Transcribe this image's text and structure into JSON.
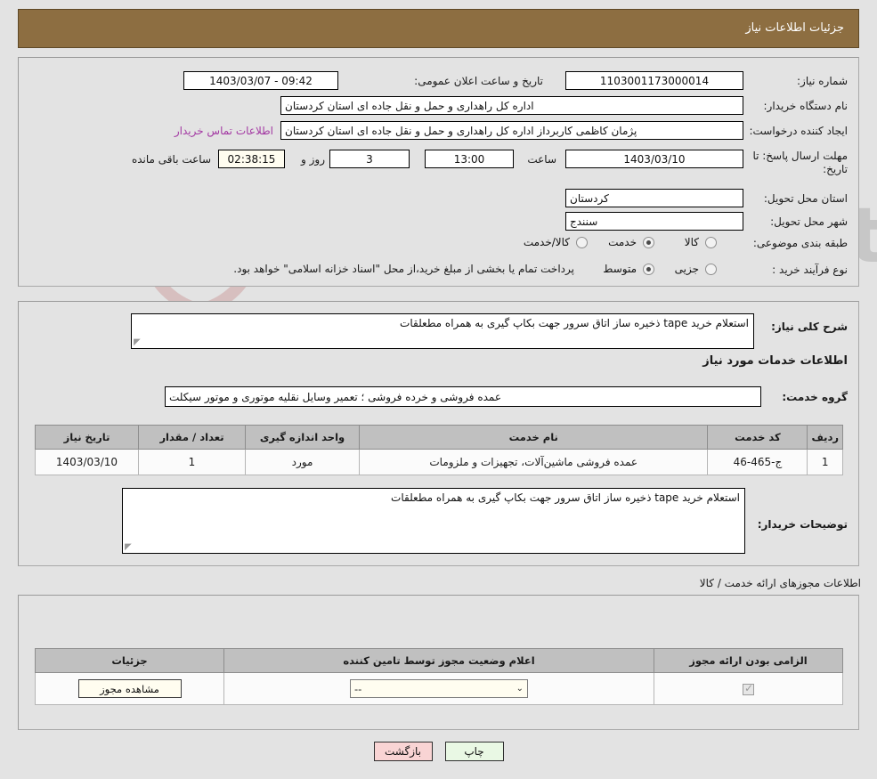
{
  "header": {
    "title": "جزئیات اطلاعات نیاز"
  },
  "watermark": {
    "text": "AriaTender.net"
  },
  "top_form": {
    "need_number_label": "شماره نیاز:",
    "need_number_value": "1103001173000014",
    "announce_datetime_label": "تاریخ و ساعت اعلان عمومی:",
    "announce_datetime_value": "1403/03/07 - 09:42",
    "buyer_org_label": "نام دستگاه خریدار:",
    "buyer_org_value": "اداره کل راهداری و حمل و نقل جاده ای استان کردستان",
    "creator_label": "ایجاد کننده درخواست:",
    "creator_value": "پژمان کاظمی کاربرداز اداره کل راهداری و حمل و نقل جاده ای استان کردستان",
    "contact_link": "اطلاعات تماس خریدار",
    "deadline_label": "مهلت ارسال پاسخ: تا تاریخ:",
    "deadline_date": "1403/03/10",
    "hour_label": "ساعت",
    "deadline_time": "13:00",
    "days_value": "3",
    "days_label": "روز و",
    "countdown_value": "02:38:15",
    "countdown_label": "ساعت باقی مانده",
    "province_label": "استان محل تحویل:",
    "province_value": "کردستان",
    "city_label": "شهر محل تحویل:",
    "city_value": "سنندج",
    "category_label": "طبقه بندی موضوعی:",
    "category_options": [
      {
        "label": "کالا",
        "selected": false
      },
      {
        "label": "خدمت",
        "selected": true
      },
      {
        "label": "کالا/خدمت",
        "selected": false
      }
    ],
    "process_label": "نوع فرآیند خرید :",
    "process_options": [
      {
        "label": "جزیی",
        "selected": false
      },
      {
        "label": "متوسط",
        "selected": true
      }
    ],
    "process_note": "پرداخت تمام یا بخشی از مبلغ خرید،از محل \"اسناد خزانه اسلامی\" خواهد بود."
  },
  "description": {
    "label": "شرح کلی نیاز:",
    "value": "استعلام خرید tape ذخیره ساز اتاق سرور جهت بکاپ گیری به همراه مطعلقات"
  },
  "services_section": {
    "heading": "اطلاعات خدمات مورد نیاز",
    "group_label": "گروه خدمت:",
    "group_value": "عمده فروشی و خرده فروشی ؛ تعمیر وسایل نقلیه موتوری و موتور سیکلت",
    "table": {
      "columns": [
        "ردیف",
        "کد خدمت",
        "نام خدمت",
        "واحد اندازه گیری",
        "تعداد / مقدار",
        "تاریخ نیاز"
      ],
      "rows": [
        [
          "1",
          "ج-465-46",
          "عمده فروشی ماشین‌آلات، تجهیزات و ملزومات",
          "مورد",
          "1",
          "1403/03/10"
        ]
      ]
    }
  },
  "buyer_notes": {
    "label": "توضیحات خریدار:",
    "value": "استعلام خرید tape ذخیره ساز اتاق سرور جهت بکاپ گیری به همراه مطعلقات"
  },
  "permits_section": {
    "caption": "اطلاعات مجوزهای ارائه خدمت / کالا",
    "columns": [
      "الزامی بودن ارائه مجوز",
      "اعلام وضعیت مجوز توسط تامین کننده",
      "جزئیات"
    ],
    "rows": [
      {
        "required_checked": true,
        "status_value": "--",
        "details_button": "مشاهده مجوز"
      }
    ]
  },
  "footer": {
    "back_button": "بازگشت",
    "print_button": "چاپ"
  }
}
